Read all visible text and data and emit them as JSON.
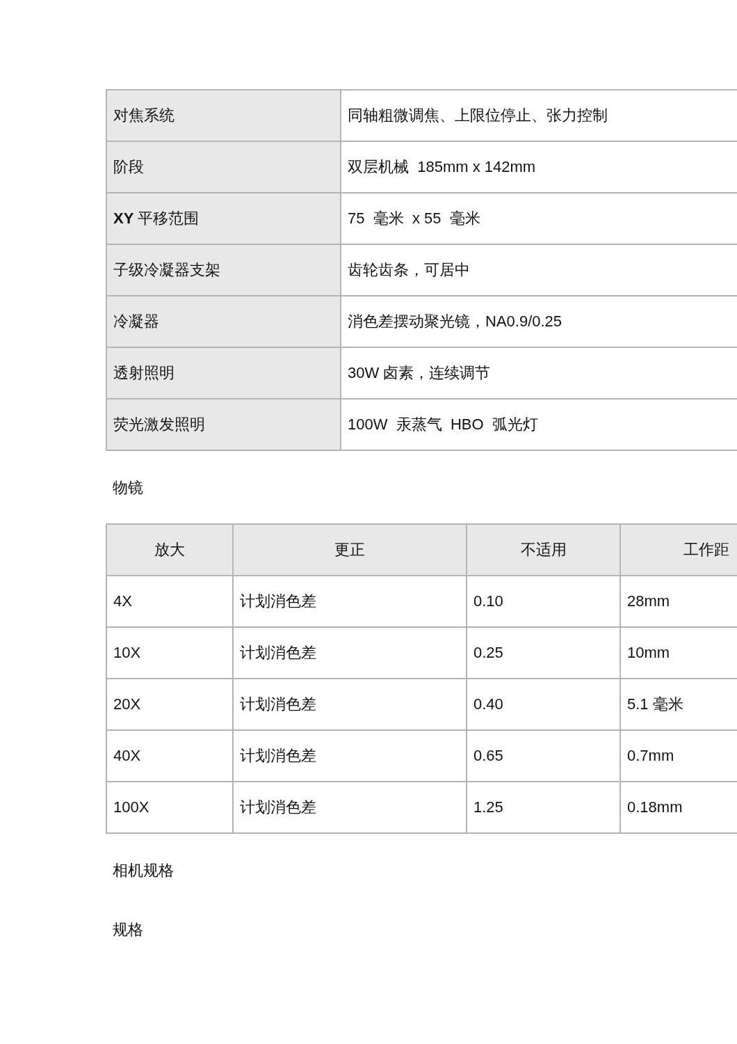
{
  "spec_table": {
    "rows": [
      {
        "label": "对焦系统",
        "value": "同轴粗微调焦、上限位停止、张力控制"
      },
      {
        "label": "阶段",
        "value": "双层机械  185mm x 142mm"
      },
      {
        "label": "**XY** 平移范围",
        "value": "75  毫米  x 55  毫米"
      },
      {
        "label": "子级冷凝器支架",
        "value": "齿轮齿条，可居中"
      },
      {
        "label": "冷凝器",
        "value": "消色差摆动聚光镜，NA0.9/0.25"
      },
      {
        "label": "透射照明",
        "value": "30W 卤素，连续调节"
      },
      {
        "label": "荧光激发照明",
        "value": "100W  汞蒸气  HBO  弧光灯"
      }
    ]
  },
  "objectives_heading": "物镜",
  "objectives_table": {
    "columns": [
      "放大",
      "更正",
      "不适用",
      "工作距"
    ],
    "rows": [
      [
        "4X",
        "计划消色差",
        "0.10",
        "28mm"
      ],
      [
        "10X",
        "计划消色差",
        "0.25",
        "10mm"
      ],
      [
        "20X",
        "计划消色差",
        "0.40",
        "5.1 毫米"
      ],
      [
        "40X",
        "计划消色差",
        "0.65",
        "0.7mm"
      ],
      [
        "100X",
        "计划消色差",
        "1.25",
        "0.18mm"
      ]
    ]
  },
  "camera_heading": "相机规格",
  "specs_heading": "规格"
}
